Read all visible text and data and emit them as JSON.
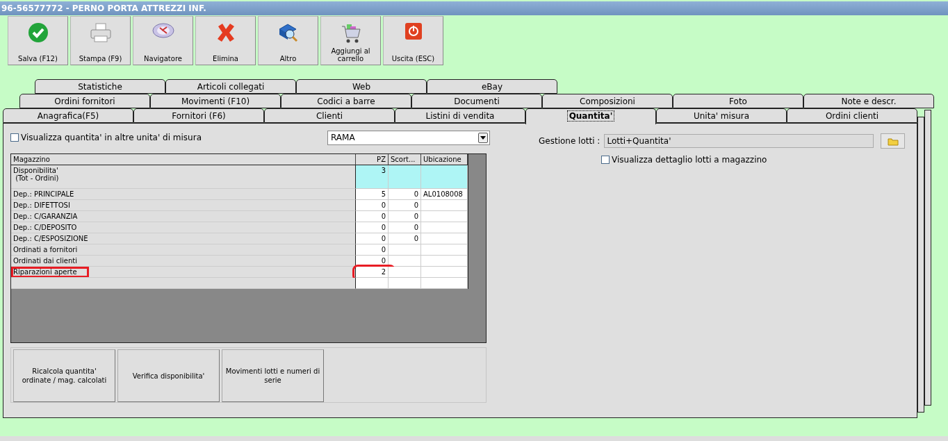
{
  "window": {
    "title": "96-56577772 - PERNO PORTA ATTREZZI INF."
  },
  "toolbar": [
    {
      "label": "Salva (F12)",
      "kind": "check"
    },
    {
      "label": "Stampa (F9)",
      "kind": "printer"
    },
    {
      "label": "Navigatore",
      "kind": "compass"
    },
    {
      "label": "Elimina",
      "kind": "cross"
    },
    {
      "label": "Altro",
      "kind": "book"
    },
    {
      "label": "Aggiungi al carrello",
      "kind": "cart"
    },
    {
      "label": "Uscita (ESC)",
      "kind": "power"
    }
  ],
  "tab_rows": [
    [
      {
        "label": "Statistiche",
        "selected": false
      },
      {
        "label": "Articoli collegati",
        "selected": false
      },
      {
        "label": "Web",
        "selected": false
      },
      {
        "label": "eBay",
        "selected": false
      }
    ],
    [
      {
        "label": "Ordini fornitori",
        "selected": false
      },
      {
        "label": "Movimenti (F10)",
        "selected": false
      },
      {
        "label": "Codici a barre",
        "selected": false
      },
      {
        "label": "Documenti",
        "selected": false
      },
      {
        "label": "Composizioni",
        "selected": false
      },
      {
        "label": "Foto",
        "selected": false
      },
      {
        "label": "Note e descr.",
        "selected": false
      }
    ],
    [
      {
        "label": "Anagrafica(F5)",
        "selected": false
      },
      {
        "label": "Fornitori (F6)",
        "selected": false
      },
      {
        "label": "Clienti",
        "selected": false
      },
      {
        "label": "Listini di vendita",
        "selected": false
      },
      {
        "label": "Quantita'",
        "selected": true
      },
      {
        "label": "Unita' misura",
        "selected": false
      },
      {
        "label": "Ordini clienti",
        "selected": false
      }
    ]
  ],
  "units_checkbox": {
    "label": "Visualizza quantita' in altre unita' di misura",
    "checked": false
  },
  "unit_select": {
    "value": "RAMA"
  },
  "table": {
    "columns": [
      "Magazzino",
      "PZ",
      "Scort...",
      "Ubicazione"
    ],
    "rows": [
      {
        "cells": [
          "Disponibilita'\n (Tot - Ordini)",
          "3",
          "",
          ""
        ],
        "kind": "summary",
        "highlighted": false
      },
      {
        "cells": [
          "Dep.: PRINCIPALE",
          "5",
          "0",
          "AL0108008"
        ],
        "kind": "normal",
        "highlighted": false
      },
      {
        "cells": [
          "Dep.: DIFETTOSI",
          "0",
          "0",
          ""
        ],
        "kind": "normal",
        "highlighted": false
      },
      {
        "cells": [
          "Dep.: C/GARANZIA",
          "0",
          "0",
          ""
        ],
        "kind": "normal",
        "highlighted": false
      },
      {
        "cells": [
          "Dep.: C/DEPOSITO",
          "0",
          "0",
          ""
        ],
        "kind": "normal",
        "highlighted": false
      },
      {
        "cells": [
          "Dep.: C/ESPOSIZIONE",
          "0",
          "0",
          ""
        ],
        "kind": "normal",
        "highlighted": false
      },
      {
        "cells": [
          "Ordinati a fornitori",
          "0",
          "",
          ""
        ],
        "kind": "normal",
        "highlighted": false
      },
      {
        "cells": [
          "Ordinati dai clienti",
          "0",
          "",
          ""
        ],
        "kind": "normal",
        "highlighted": false
      },
      {
        "cells": [
          "Riparazioni aperte",
          "2",
          "",
          ""
        ],
        "kind": "normal",
        "highlighted": true
      },
      {
        "cells": [
          "",
          "",
          "",
          ""
        ],
        "kind": "normal",
        "highlighted": false
      }
    ]
  },
  "actions": [
    "Ricalcola quantita' ordinate / mag. calcolati",
    "Verifica disponibilita'",
    "Movimenti lotti e numeri di serie"
  ],
  "lots": {
    "label": "Gestione lotti :",
    "value": "Lotti+Quantita'",
    "checkbox": {
      "label": "Visualizza dettaglio lotti a magazzino",
      "checked": false
    }
  }
}
